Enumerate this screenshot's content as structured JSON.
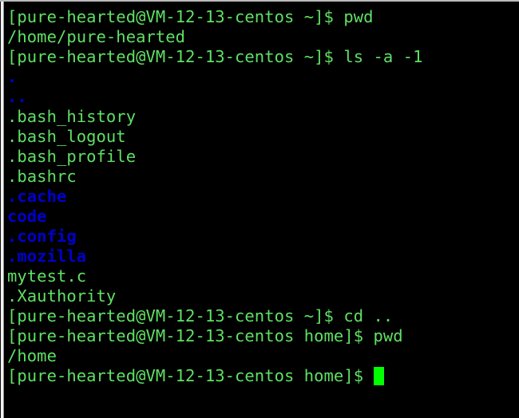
{
  "terminal": {
    "background_color": "#000000",
    "foreground_color": "#5fe064",
    "directory_color": "#0000cd",
    "cursor_color": "#00ff00",
    "prompt_user_host": "[pure-hearted@VM-12-13-centos",
    "lines": [
      {
        "text": "[pure-hearted@VM-12-13-centos ~]$ pwd",
        "kind": "prompt"
      },
      {
        "text": "/home/pure-hearted",
        "kind": "output"
      },
      {
        "text": "[pure-hearted@VM-12-13-centos ~]$ ls -a -1",
        "kind": "prompt"
      },
      {
        "text": ".",
        "kind": "dir"
      },
      {
        "text": "..",
        "kind": "dir"
      },
      {
        "text": ".bash_history",
        "kind": "file"
      },
      {
        "text": ".bash_logout",
        "kind": "file"
      },
      {
        "text": ".bash_profile",
        "kind": "file"
      },
      {
        "text": ".bashrc",
        "kind": "file"
      },
      {
        "text": ".cache",
        "kind": "dir"
      },
      {
        "text": "code",
        "kind": "dir"
      },
      {
        "text": ".config",
        "kind": "dir"
      },
      {
        "text": ".mozilla",
        "kind": "dir"
      },
      {
        "text": "mytest.c",
        "kind": "file"
      },
      {
        "text": ".Xauthority",
        "kind": "file"
      },
      {
        "text": "[pure-hearted@VM-12-13-centos ~]$ cd ..",
        "kind": "prompt"
      },
      {
        "text": "[pure-hearted@VM-12-13-centos home]$ pwd",
        "kind": "prompt"
      },
      {
        "text": "/home",
        "kind": "output"
      },
      {
        "text": "[pure-hearted@VM-12-13-centos home]$ ",
        "kind": "cursor"
      }
    ]
  }
}
